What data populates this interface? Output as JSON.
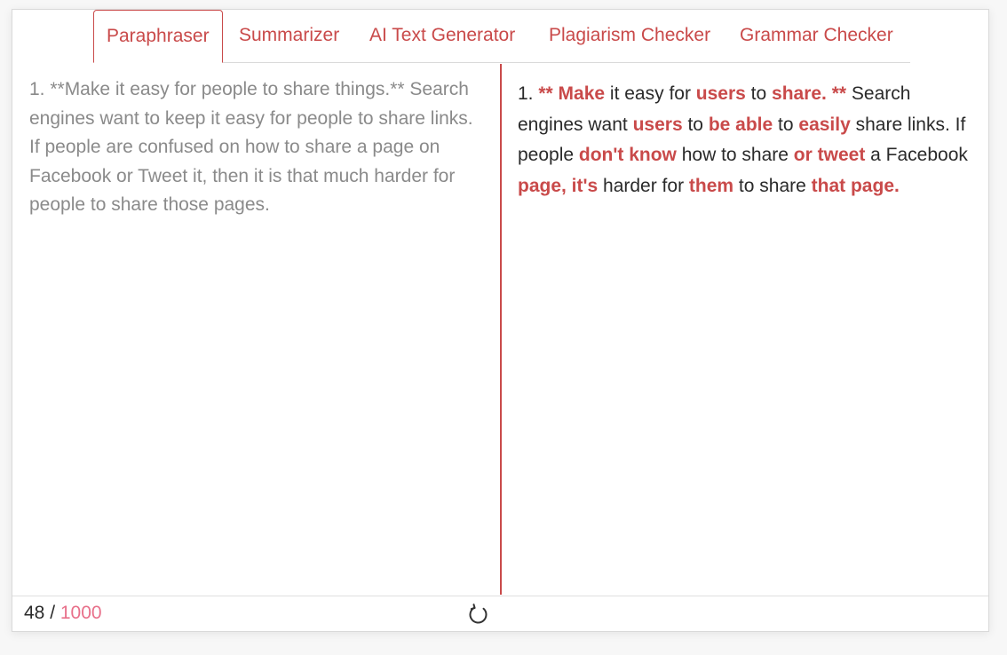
{
  "tabs": [
    {
      "label": "Paraphraser",
      "active": true
    },
    {
      "label": "Summarizer",
      "active": false
    },
    {
      "label": "AI Text Generator",
      "active": false
    },
    {
      "label": "Plagiarism Checker",
      "active": false
    },
    {
      "label": "Grammar Checker",
      "active": false
    }
  ],
  "input": {
    "text": "1. **Make it easy for people to share things.** Search engines want to keep it easy for people to share links. If people are confused on how to share a page on Facebook or Tweet it, then it is that much harder for people to share those pages."
  },
  "output": {
    "segments": [
      {
        "text": "1. ",
        "changed": false
      },
      {
        "text": "** Make",
        "changed": true
      },
      {
        "text": " it easy for ",
        "changed": false
      },
      {
        "text": "users",
        "changed": true
      },
      {
        "text": " to ",
        "changed": false
      },
      {
        "text": "share. **",
        "changed": true
      },
      {
        "text": " Search engines want ",
        "changed": false
      },
      {
        "text": "users",
        "changed": true
      },
      {
        "text": " to ",
        "changed": false
      },
      {
        "text": "be able",
        "changed": true
      },
      {
        "text": " to ",
        "changed": false
      },
      {
        "text": "easily",
        "changed": true
      },
      {
        "text": " share links. If people ",
        "changed": false
      },
      {
        "text": "don't know",
        "changed": true
      },
      {
        "text": " how to share ",
        "changed": false
      },
      {
        "text": "or tweet",
        "changed": true
      },
      {
        "text": " a Facebook ",
        "changed": false
      },
      {
        "text": "page, it's",
        "changed": true
      },
      {
        "text": " harder for ",
        "changed": false
      },
      {
        "text": "them",
        "changed": true
      },
      {
        "text": " to share ",
        "changed": false
      },
      {
        "text": "that page.",
        "changed": true
      }
    ]
  },
  "footer": {
    "word_count": "48",
    "separator": " / ",
    "word_limit": "1000",
    "refresh_icon": "refresh-icon"
  },
  "colors": {
    "accent": "#c94a4a",
    "limit": "#e8708a",
    "input_text": "#8a8a8a",
    "output_text": "#2a2a2a"
  }
}
